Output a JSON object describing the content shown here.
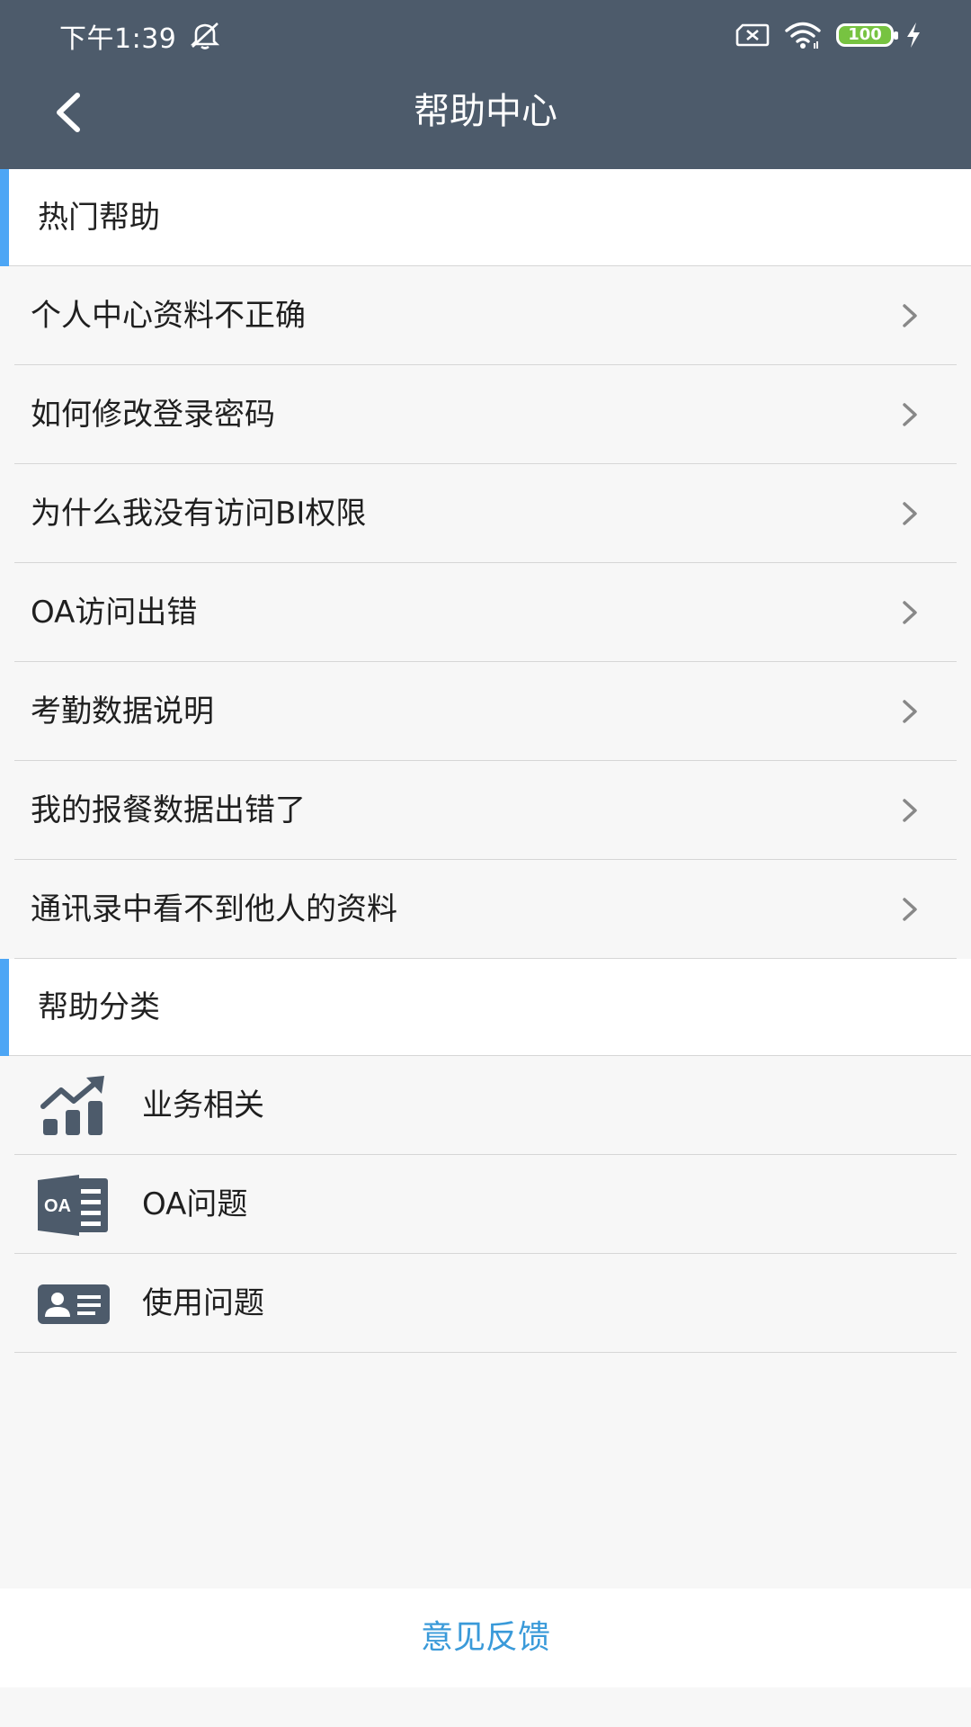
{
  "status_bar": {
    "time": "下午1:39",
    "battery_level": "100",
    "icons": [
      "mute-icon",
      "sim-icon",
      "wifi-icon",
      "battery-icon",
      "bolt-icon"
    ]
  },
  "header": {
    "title": "帮助中心",
    "back_icon": "chevron-left-icon",
    "background_color": "#4d5b6b"
  },
  "hot_help": {
    "title": "热门帮助",
    "items": [
      {
        "label": "个人中心资料不正确"
      },
      {
        "label": "如何修改登录密码"
      },
      {
        "label": "为什么我没有访问BI权限"
      },
      {
        "label": "OA访问出错"
      },
      {
        "label": "考勤数据说明"
      },
      {
        "label": "我的报餐数据出错了"
      },
      {
        "label": "通讯录中看不到他人的资料"
      }
    ]
  },
  "categories": {
    "title": "帮助分类",
    "items": [
      {
        "label": "业务相关",
        "icon": "chart-trend-icon"
      },
      {
        "label": "OA问题",
        "icon": "oa-document-icon",
        "icon_text": "OA"
      },
      {
        "label": "使用问题",
        "icon": "id-card-icon"
      }
    ]
  },
  "footer": {
    "feedback_label": "意见反馈",
    "feedback_color": "#3a9ad9"
  },
  "colors": {
    "accent_bar": "#4da6f5",
    "icon_dark": "#4d5b6b"
  }
}
